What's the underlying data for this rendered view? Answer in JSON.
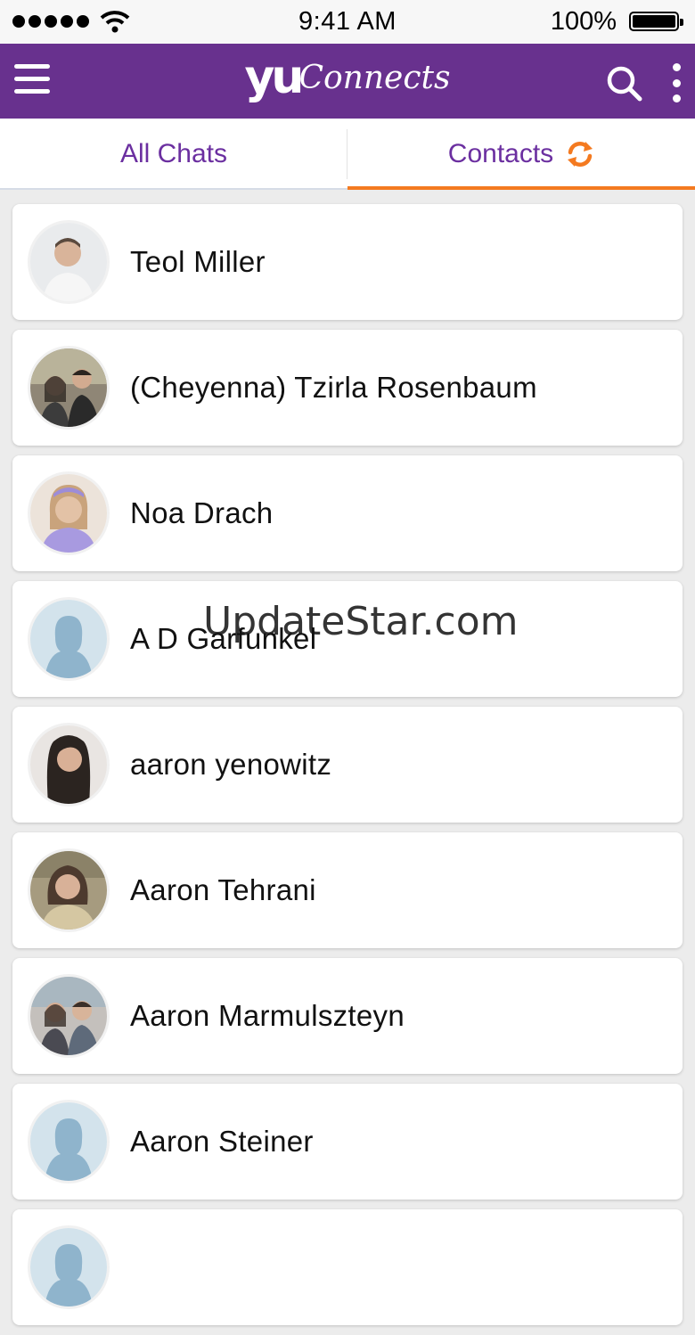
{
  "status_bar": {
    "time": "9:41 AM",
    "battery": "100%"
  },
  "header": {
    "logo_yu": "yu",
    "logo_connects": "Connects"
  },
  "tabs": [
    {
      "label": "All Chats",
      "active": false
    },
    {
      "label": "Contacts",
      "active": true
    }
  ],
  "contacts": [
    {
      "name": "Teol Miller",
      "avatar": "photo-man"
    },
    {
      "name": "(Cheyenna) Tzirla Rosenbaum",
      "avatar": "photo-couple"
    },
    {
      "name": "Noa Drach",
      "avatar": "photo-woman-headband"
    },
    {
      "name": "A D Garfunkel",
      "avatar": "default-silhouette"
    },
    {
      "name": "aaron yenowitz",
      "avatar": "photo-woman-dark-hair"
    },
    {
      "name": "Aaron Tehrani",
      "avatar": "photo-woman"
    },
    {
      "name": "Aaron Marmulszteyn",
      "avatar": "photo-couple"
    },
    {
      "name": "Aaron Steiner",
      "avatar": "default-silhouette"
    },
    {
      "name": "",
      "avatar": "default-silhouette"
    }
  ],
  "watermark": "UpdateStar.com",
  "colors": {
    "header": "#68318e",
    "tab_text": "#6b2fa0",
    "accent": "#f47a20",
    "silhouette_bg": "#d3e3ec",
    "silhouette": "#8fb4cc"
  }
}
